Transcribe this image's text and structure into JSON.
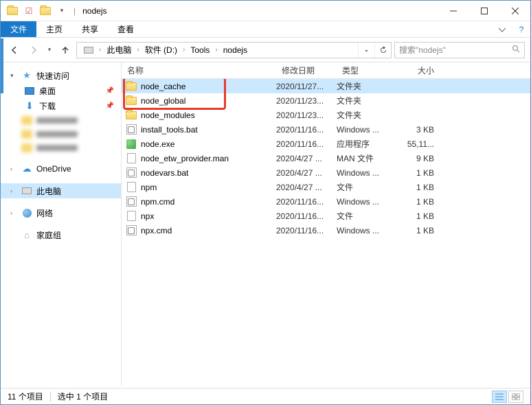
{
  "window": {
    "title": "nodejs"
  },
  "ribbon": {
    "file": "文件",
    "home": "主页",
    "share": "共享",
    "view": "查看"
  },
  "breadcrumb": [
    "此电脑",
    "软件 (D:)",
    "Tools",
    "nodejs"
  ],
  "search": {
    "placeholder": "搜索\"nodejs\""
  },
  "sidebar": {
    "quick": "快速访问",
    "desktop": "桌面",
    "downloads": "下载",
    "onedrive": "OneDrive",
    "thispc": "此电脑",
    "network": "网络",
    "homegroup": "家庭组"
  },
  "columns": {
    "name": "名称",
    "date": "修改日期",
    "type": "类型",
    "size": "大小"
  },
  "files": [
    {
      "icon": "folder",
      "name": "node_cache",
      "date": "2020/11/27...",
      "type": "文件夹",
      "size": "",
      "selected": true
    },
    {
      "icon": "folder",
      "name": "node_global",
      "date": "2020/11/23...",
      "type": "文件夹",
      "size": ""
    },
    {
      "icon": "folder",
      "name": "node_modules",
      "date": "2020/11/23...",
      "type": "文件夹",
      "size": ""
    },
    {
      "icon": "bat",
      "name": "install_tools.bat",
      "date": "2020/11/16...",
      "type": "Windows ...",
      "size": "3 KB"
    },
    {
      "icon": "exe",
      "name": "node.exe",
      "date": "2020/11/16...",
      "type": "应用程序",
      "size": "55,11..."
    },
    {
      "icon": "file",
      "name": "node_etw_provider.man",
      "date": "2020/4/27 ...",
      "type": "MAN 文件",
      "size": "9 KB"
    },
    {
      "icon": "bat",
      "name": "nodevars.bat",
      "date": "2020/4/27 ...",
      "type": "Windows ...",
      "size": "1 KB"
    },
    {
      "icon": "file",
      "name": "npm",
      "date": "2020/4/27 ...",
      "type": "文件",
      "size": "1 KB"
    },
    {
      "icon": "bat",
      "name": "npm.cmd",
      "date": "2020/11/16...",
      "type": "Windows ...",
      "size": "1 KB"
    },
    {
      "icon": "file",
      "name": "npx",
      "date": "2020/11/16...",
      "type": "文件",
      "size": "1 KB"
    },
    {
      "icon": "bat",
      "name": "npx.cmd",
      "date": "2020/11/16...",
      "type": "Windows ...",
      "size": "1 KB"
    }
  ],
  "status": {
    "count": "11 个项目",
    "selected": "选中 1 个项目"
  },
  "annotation": {
    "highlight_rows": [
      0,
      1
    ]
  }
}
